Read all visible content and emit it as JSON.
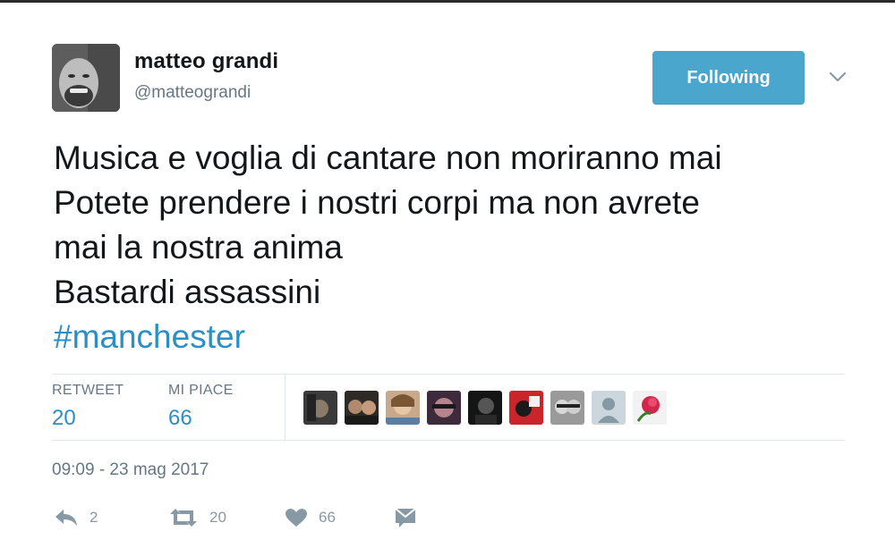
{
  "header": {
    "display_name": "matteo grandi",
    "handle": "@matteograndi",
    "follow_label": "Following"
  },
  "tweet": {
    "lines": [
      "Musica e voglia di cantare non moriranno mai",
      "Potete prendere i nostri corpi ma non avrete",
      "mai la nostra anima",
      "Bastardi assassini"
    ],
    "hashtag": "#manchester"
  },
  "stats": {
    "retweets_label": "RETWEET",
    "retweets": "20",
    "likes_label": "MI PIACE",
    "likes": "66"
  },
  "likers": [
    "liker-1",
    "liker-2",
    "liker-3",
    "liker-4",
    "liker-5",
    "liker-6",
    "liker-7",
    "liker-8",
    "liker-9"
  ],
  "timestamp": "09:09 - 23 mag 2017",
  "actions": {
    "reply_count": "2",
    "retweet_count": "20",
    "like_count": "66"
  },
  "colors": {
    "accent": "#2b8fc6",
    "button": "#4aa6cd",
    "muted": "#657786",
    "icon": "#8899a6"
  }
}
